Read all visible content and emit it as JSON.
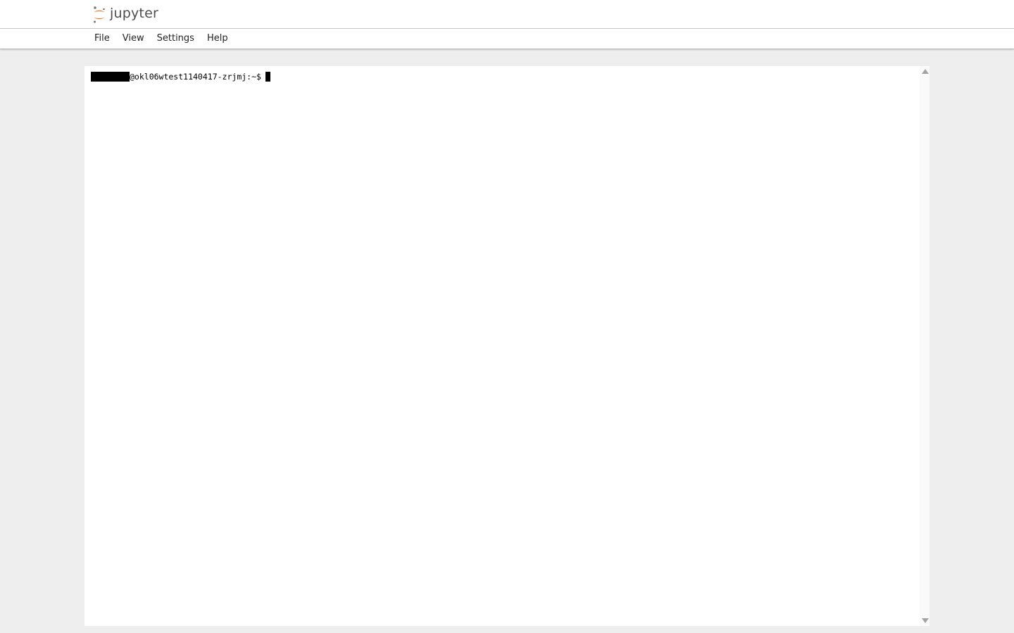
{
  "app": {
    "logo_text": "jupyter",
    "logo_icon": "jupyter-logo-icon",
    "brand_color": "#f37726"
  },
  "menu": {
    "items": [
      {
        "label": "File"
      },
      {
        "label": "View"
      },
      {
        "label": "Settings"
      },
      {
        "label": "Help"
      }
    ]
  },
  "terminal": {
    "prompt": "@okl06wtest1140417-zrjmj:~$",
    "username_redacted": true
  }
}
